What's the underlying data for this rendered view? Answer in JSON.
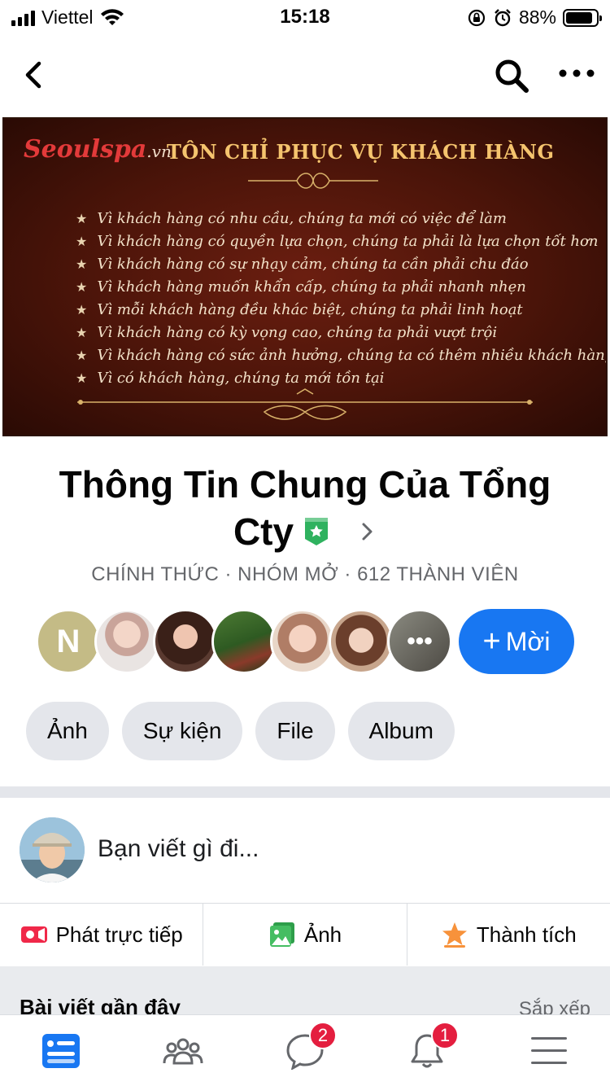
{
  "status_bar": {
    "carrier": "Viettel",
    "time": "15:18",
    "battery_percent": "88%",
    "battery_level": 0.88,
    "icons": [
      "signal-icon",
      "wifi-icon",
      "rotation-lock-icon",
      "alarm-icon",
      "battery-icon"
    ]
  },
  "nav": {
    "icons": [
      "back-chevron-icon",
      "search-icon",
      "more-dots-icon"
    ]
  },
  "cover": {
    "logo_main": "Seoulspa",
    "logo_sub": ".vn",
    "title": "TÔN CHỈ PHỤC VỤ KHÁCH HÀNG",
    "lines": [
      "Vì khách hàng có nhu cầu, chúng ta mới có việc để làm",
      "Vì khách hàng có quyền lựa chọn, chúng ta phải là lựa chọn tốt hơn",
      "Vì khách hàng có sự nhạy cảm, chúng ta cần phải chu đáo",
      "Vì khách hàng muốn khẩn cấp, chúng ta phải nhanh nhẹn",
      "Vì mỗi khách hàng đều khác biệt, chúng ta phải linh hoạt",
      "Vì khách hàng có kỳ vọng cao, chúng ta phải vượt trội",
      "Vì khách hàng có sức ảnh hưởng, chúng ta có thêm nhiều khách hàng",
      "Vì có khách hàng, chúng ta mới tồn tại"
    ]
  },
  "group": {
    "title_line1": "Thông Tin Chung Của Tổng",
    "title_line2": "Cty",
    "meta": "CHÍNH THỨC · NHÓM MỞ · 612 THÀNH VIÊN"
  },
  "members": {
    "first_initial": "N",
    "more_label": "•••",
    "invite_plus": "+",
    "invite_label": "Mời"
  },
  "chips": [
    "Ảnh",
    "Sự kiện",
    "File",
    "Album"
  ],
  "composer": {
    "placeholder": "Bạn viết gì đi..."
  },
  "actions": {
    "live": "Phát trực tiếp",
    "photo": "Ảnh",
    "achievement": "Thành tích"
  },
  "feed": {
    "recent_posts": "Bài viết gần đây",
    "sort": "Sắp xếp"
  },
  "tabs": {
    "messages_badge": "2",
    "notifications_badge": "1",
    "items": [
      "feed-tab",
      "groups-tab",
      "messages-tab",
      "notifications-tab",
      "menu-tab"
    ]
  },
  "colors": {
    "accent": "#1877f2",
    "badge_red": "#e41e3f",
    "chip_bg": "#e4e6eb",
    "meta_gray": "#65676b",
    "cover_title": "#f5c46e",
    "group_badge": "#2fb25f"
  }
}
